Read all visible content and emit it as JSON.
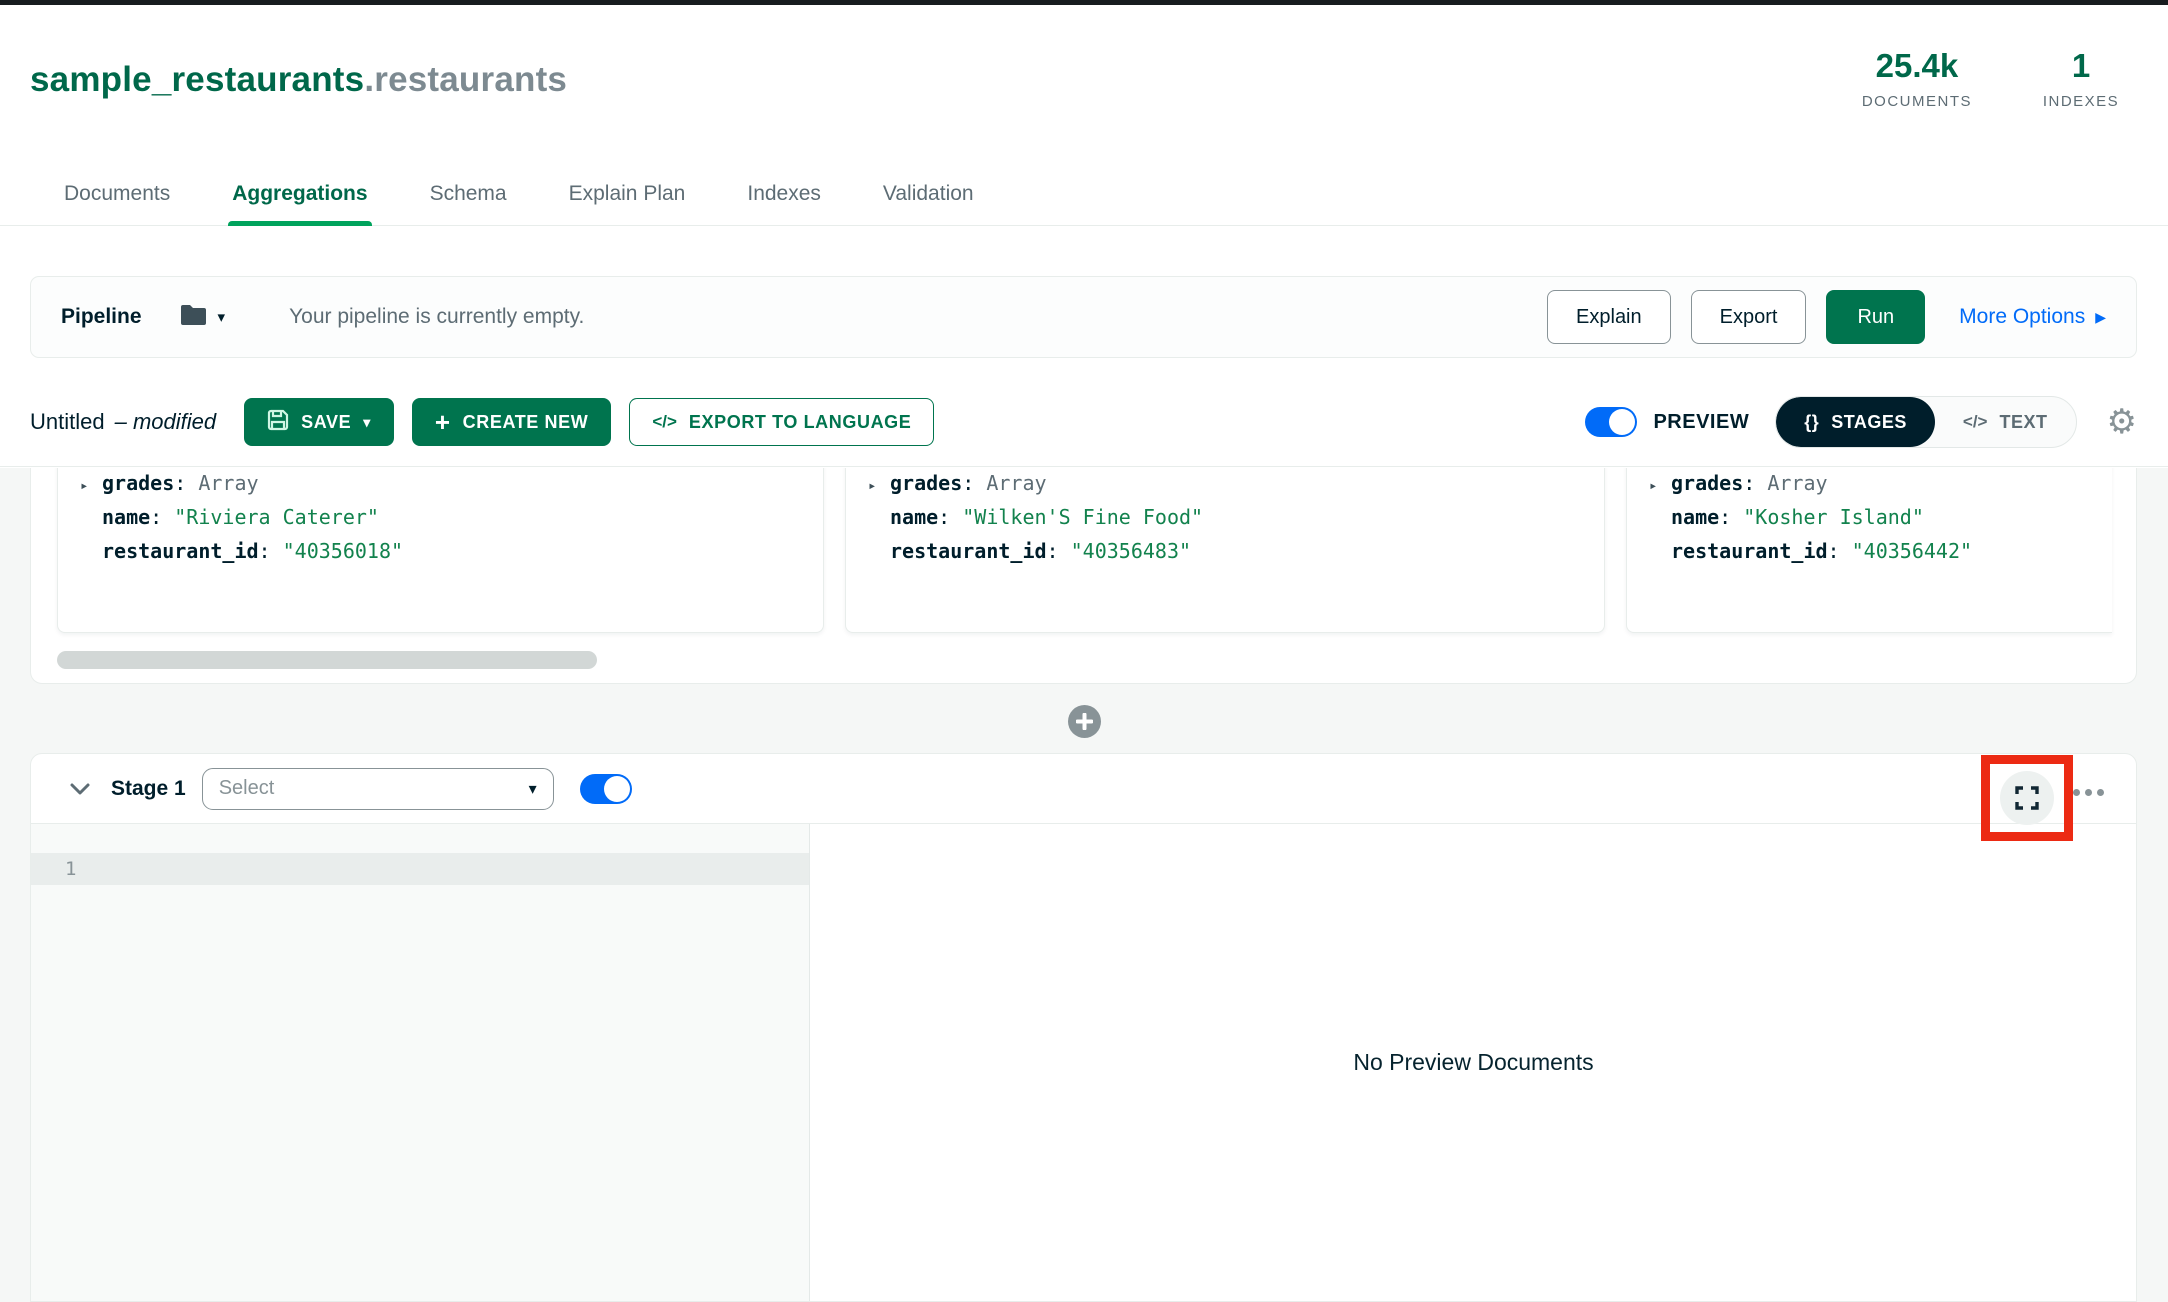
{
  "header": {
    "title": {
      "database_part": "sample_restaurants",
      "collection_part": ".restaurants"
    },
    "stats": [
      {
        "value": "25.4k",
        "label": "DOCUMENTS"
      },
      {
        "value": "1",
        "label": "INDEXES"
      }
    ],
    "tabs": [
      {
        "label": "Documents",
        "active": false
      },
      {
        "label": "Aggregations",
        "active": true
      },
      {
        "label": "Schema",
        "active": false
      },
      {
        "label": "Explain Plan",
        "active": false
      },
      {
        "label": "Indexes",
        "active": false
      },
      {
        "label": "Validation",
        "active": false
      }
    ]
  },
  "pipeline_bar": {
    "label": "Pipeline",
    "empty_message": "Your pipeline is currently empty.",
    "explain_button": "Explain",
    "export_button": "Export",
    "run_button": "Run",
    "more_options_link": "More Options"
  },
  "toolbar": {
    "pipeline_name": "Untitled",
    "modified_flag": "– modified",
    "save_button": "SAVE",
    "create_new_button": "CREATE NEW",
    "export_to_language_button": "EXPORT TO LANGUAGE",
    "preview_label": "PREVIEW",
    "preview_enabled": true,
    "view_mode": {
      "stages_label": "STAGES",
      "text_label": "TEXT",
      "selected": "STAGES"
    }
  },
  "preview_documents": [
    {
      "fields": [
        {
          "key": "grades",
          "value": "Array",
          "kind": "array"
        },
        {
          "key": "name",
          "value": "\"Riviera Caterer\"",
          "kind": "string"
        },
        {
          "key": "restaurant_id",
          "value": "\"40356018\"",
          "kind": "string"
        }
      ]
    },
    {
      "fields": [
        {
          "key": "grades",
          "value": "Array",
          "kind": "array"
        },
        {
          "key": "name",
          "value": "\"Wilken'S Fine Food\"",
          "kind": "string"
        },
        {
          "key": "restaurant_id",
          "value": "\"40356483\"",
          "kind": "string"
        }
      ]
    },
    {
      "fields": [
        {
          "key": "grades",
          "value": "Array",
          "kind": "array"
        },
        {
          "key": "name",
          "value": "\"Kosher Island\"",
          "kind": "string"
        },
        {
          "key": "restaurant_id",
          "value": "\"40356442\"",
          "kind": "string"
        }
      ]
    }
  ],
  "stage": {
    "collapse_label": "Stage 1",
    "operator_placeholder": "Select",
    "enabled": true,
    "editor": {
      "line_number": "1"
    },
    "preview_empty_message": "No Preview Documents"
  },
  "punctuation": {
    "colon": ":"
  },
  "icons": {
    "caret_down": "▾",
    "expand_triangle": "▸",
    "more_options_arrow": "▶",
    "braces": "{}",
    "code": "</>",
    "gear": "⚙",
    "plus": "+"
  },
  "colors": {
    "brand_green_dark": "#00684A",
    "button_green": "#00744E",
    "tab_underline_green": "#00A35C",
    "link_blue": "#016BF8",
    "toggle_blue": "#016BF8",
    "text_dark": "#001E2B",
    "text_gray": "#5D6C74",
    "string_value_green": "#12824D",
    "border_light": "#E8EDEB",
    "annotation_red": "#EC2A13"
  }
}
